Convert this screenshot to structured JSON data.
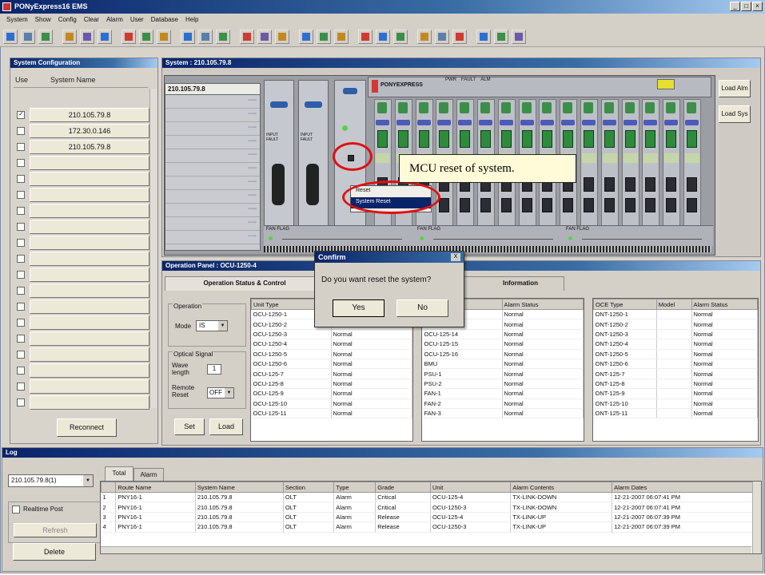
{
  "window": {
    "title": "PONyExpress16 EMS"
  },
  "menu": [
    "System",
    "Show",
    "Config",
    "Clear",
    "Alarm",
    "User",
    "Database",
    "Help"
  ],
  "left_panel": {
    "title": "System Configuration",
    "col_use": "Use",
    "col_name": "System Name",
    "systems": [
      {
        "name": "210.105.79.8",
        "checked": true
      },
      {
        "name": "172.30.0.146",
        "checked": false
      },
      {
        "name": "210.105.79.8",
        "checked": false
      }
    ],
    "reconnect": "Reconnect"
  },
  "system_panel": {
    "title": "System : 210.105.79.8",
    "rack_label": "210.105.79.8",
    "load_alarm": "Load Alm",
    "load_sys": "Load Sys",
    "brand": "PONYEXPRESS",
    "module_labels": {
      "pwr": "PWR",
      "fault": "FAULT",
      "alm": "ALM"
    },
    "power_labels": {
      "input": "INPUT",
      "fault": "FAULT"
    },
    "fan_label": "FAN FLAG"
  },
  "context_menu": {
    "items": [
      "Reset",
      "System Reset"
    ]
  },
  "callout": "MCU reset of system.",
  "ops_panel": {
    "title": "Operation Panel : OCU-1250-4",
    "tab_status": "Operation Status & Control",
    "tab_info": "Information",
    "operation_label": "Operation",
    "mode_label": "Mode",
    "mode_value": "IS",
    "optical_label": "Optical Signal",
    "wave_label": "Wave length",
    "wave_value": "1",
    "remote_label": "Remote Reset",
    "remote_value": "OFF",
    "set": "Set",
    "load": "Load",
    "grid1": {
      "headers": [
        "Unit Type",
        "Alarm Status"
      ],
      "rows": [
        [
          "OCU-1250-1",
          "Normal"
        ],
        [
          "OCU-1250-2",
          "Normal"
        ],
        [
          "OCU-1250-3",
          "Normal"
        ],
        [
          "OCU-1250-4",
          "Normal"
        ],
        [
          "OCU-1250-5",
          "Normal"
        ],
        [
          "OCU-1250-6",
          "Normal"
        ],
        [
          "OCU-125-7",
          "Normal"
        ],
        [
          "OCU-125-8",
          "Normal"
        ],
        [
          "OCU-125-9",
          "Normal"
        ],
        [
          "OCU-125-10",
          "Normal"
        ],
        [
          "OCU-125-11",
          "Normal"
        ]
      ]
    },
    "grid2": {
      "headers": [
        "Unit Type",
        "Alarm Status"
      ],
      "rows": [
        [
          "OCU-125-12",
          "Normal"
        ],
        [
          "OCU-125-13",
          "Normal"
        ],
        [
          "OCU-125-14",
          "Normal"
        ],
        [
          "OCU-125-15",
          "Normal"
        ],
        [
          "OCU-125-16",
          "Normal"
        ],
        [
          "BMU",
          "Normal"
        ],
        [
          "PSU-1",
          "Normal"
        ],
        [
          "PSU-2",
          "Normal"
        ],
        [
          "FAN-1",
          "Normal"
        ],
        [
          "FAN-2",
          "Normal"
        ],
        [
          "FAN-3",
          "Normal"
        ]
      ]
    },
    "grid3": {
      "headers": [
        "OCE Type",
        "Model",
        "Alarm Status"
      ],
      "rows": [
        [
          "ONT-1250-1",
          "",
          "Normal"
        ],
        [
          "ONT-1250-2",
          "",
          "Normal"
        ],
        [
          "ONT-1250-3",
          "",
          "Normal"
        ],
        [
          "ONT-1250-4",
          "",
          "Normal"
        ],
        [
          "ONT-1250-5",
          "",
          "Normal"
        ],
        [
          "ONT-1250-6",
          "",
          "Normal"
        ],
        [
          "ONT-125-7",
          "",
          "Normal"
        ],
        [
          "ONT-125-8",
          "",
          "Normal"
        ],
        [
          "ONT-125-9",
          "",
          "Normal"
        ],
        [
          "ONT-125-10",
          "",
          "Normal"
        ],
        [
          "ONT-125-11",
          "",
          "Normal"
        ]
      ]
    }
  },
  "dialog": {
    "title": "Confirm",
    "message": "Do you want reset the system?",
    "yes": "Yes",
    "no": "No",
    "close": "X"
  },
  "log_panel": {
    "title": "Log",
    "system_select": "210.105.79.8(1)",
    "tab_total": "Total",
    "tab_alarm": "Alarm",
    "realtime_label": "Realtime Post",
    "refresh": "Refresh",
    "delete": "Delete",
    "headers": [
      "",
      "Route Name",
      "System Name",
      "Section",
      "Type",
      "Grade",
      "Unit",
      "Alarm Contents",
      "Alarm Dates"
    ],
    "rows": [
      [
        "1",
        "PNY16-1",
        "210.105.79.8",
        "OLT",
        "Alarm",
        "Critical",
        "OCU-125-4",
        "TX-LINK-DOWN",
        "12-21-2007 06:07:41 PM"
      ],
      [
        "2",
        "PNY16-1",
        "210.105.79.8",
        "OLT",
        "Alarm",
        "Critical",
        "OCU-1250-3",
        "TX-LINK-DOWN",
        "12-21-2007 06:07:41 PM"
      ],
      [
        "3",
        "PNY16-1",
        "210.105.79.8",
        "OLT",
        "Alarm",
        "Release",
        "OCU-125-4",
        "TX-LINK-UP",
        "12-21-2007 06:07:39 PM"
      ],
      [
        "4",
        "PNY16-1",
        "210.105.79.8",
        "OLT",
        "Alarm",
        "Release",
        "OCU-1250-3",
        "TX-LINK-UP",
        "12-21-2007 06:07:39 PM"
      ]
    ]
  },
  "colors": {
    "title_blue": "#0a246a",
    "highlight_red": "#e01010",
    "card_green": "#2e8b3c",
    "callout_bg": "#fffbd8"
  }
}
